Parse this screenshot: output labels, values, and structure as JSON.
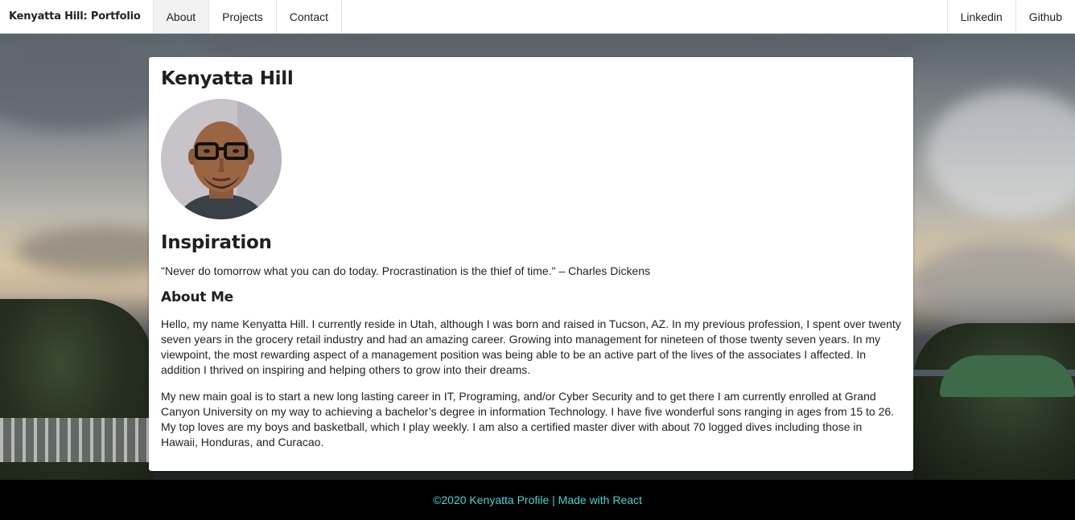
{
  "nav": {
    "brand": "Kenyatta Hill: Portfolio",
    "items": [
      {
        "label": "About",
        "active": true
      },
      {
        "label": "Projects",
        "active": false
      },
      {
        "label": "Contact",
        "active": false
      }
    ],
    "right": [
      {
        "label": "Linkedin"
      },
      {
        "label": "Github"
      }
    ]
  },
  "profile": {
    "name": "Kenyatta Hill",
    "inspiration_heading": "Inspiration",
    "quote": "\"Never do tomorrow what you can do today. Procrastination is the thief of time.\" – Charles Dickens",
    "about_heading": "About Me",
    "paragraphs": [
      "Hello, my name Kenyatta Hill. I currently reside in Utah, although I was born and raised in Tucson, AZ. In my previous profession, I spent over twenty seven years in the grocery retail industry and had an amazing career. Growing into management for nineteen of those twenty seven years. In my viewpoint, the most rewarding aspect of a management position was being able to be an active part of the lives of the associates I affected. In addition I thrived on inspiring and helping others to grow into their dreams.",
      "My new main goal is to start a new long lasting career in IT, Programing, and/or Cyber Security and to get there I am currently enrolled at Grand Canyon University on my way to achieving a bachelor’s degree in information Technology. I have five wonderful sons ranging in ages from 15 to 26. My top loves are my boys and basketball, which I play weekly. I am also a certified master diver with about 70 logged dives including those in Hawaii, Honduras, and Curacao."
    ]
  },
  "footer": {
    "text": "©2020 Kenyatta Profile | Made with React"
  },
  "colors": {
    "footer_text": "#45d4d8",
    "footer_bg": "#000000",
    "active_nav_bg": "#f2f2f2"
  }
}
